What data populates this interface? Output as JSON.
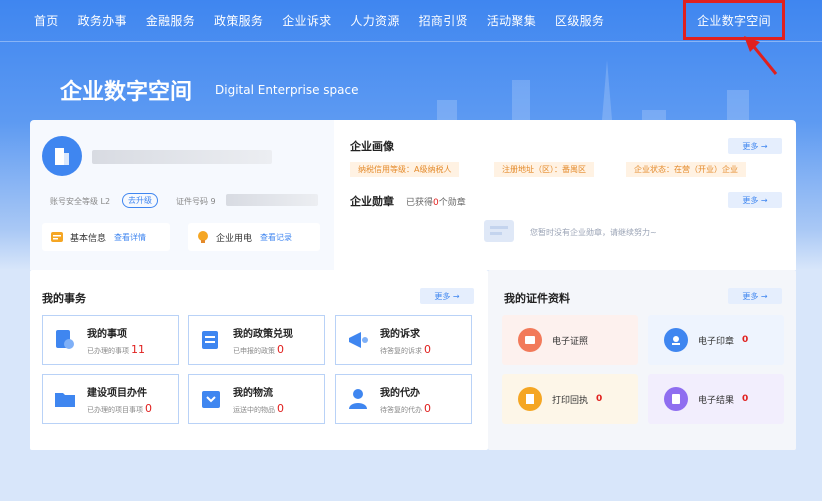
{
  "nav": {
    "items": [
      "首页",
      "政务办事",
      "金融服务",
      "政策服务",
      "企业诉求",
      "人力资源",
      "招商引贤",
      "活动聚集",
      "区级服务"
    ],
    "active": "企业数字空间"
  },
  "hero": {
    "title": "企业数字空间",
    "subtitle": "Digital Enterprise space"
  },
  "profile": {
    "security_label": "账号安全等级 L2",
    "upgrade_label": "去升级",
    "cert_label": "证件号码 9",
    "basic_info": "基本信息",
    "basic_info_link": "查看详情",
    "power": "企业用电",
    "power_link": "查看记录"
  },
  "portrait": {
    "title": "企业画像",
    "more": "更多 →",
    "tags": [
      "纳税信用等级：A级纳税人",
      "注册地址（区）：番禺区",
      "企业状态：在营（开业）企业"
    ],
    "medal_title": "企业勋章",
    "medal_prefix": "已获得",
    "medal_count": "0",
    "medal_suffix": "个勋章",
    "medal_more": "更多 →",
    "empty": "您暂时没有企业勋章，请继续努力~"
  },
  "affairs": {
    "title": "我的事务",
    "more": "更多 →",
    "items": [
      {
        "name": "我的事项",
        "sub": "已办理的事项",
        "count": "11"
      },
      {
        "name": "我的政策兑现",
        "sub": "已申报的政策",
        "count": "0"
      },
      {
        "name": "我的诉求",
        "sub": "待答复的诉求",
        "count": "0"
      },
      {
        "name": "建设项目办件",
        "sub": "已办理的项目事项",
        "count": "0"
      },
      {
        "name": "我的物流",
        "sub": "运送中的物品",
        "count": "0"
      },
      {
        "name": "我的代办",
        "sub": "待答复的代办",
        "count": "0"
      }
    ]
  },
  "certs": {
    "title": "我的证件资料",
    "more": "更多 →",
    "items": [
      {
        "name": "电子证照",
        "count": ""
      },
      {
        "name": "电子印章",
        "count": "0"
      },
      {
        "name": "打印回执",
        "count": "0"
      },
      {
        "name": "电子结果",
        "count": "0"
      }
    ]
  },
  "colors": {
    "brand": "#3f86f0",
    "highlight": "#e0201e",
    "tag_bg": "#fff2e3",
    "tag_text": "#e48a2a"
  }
}
